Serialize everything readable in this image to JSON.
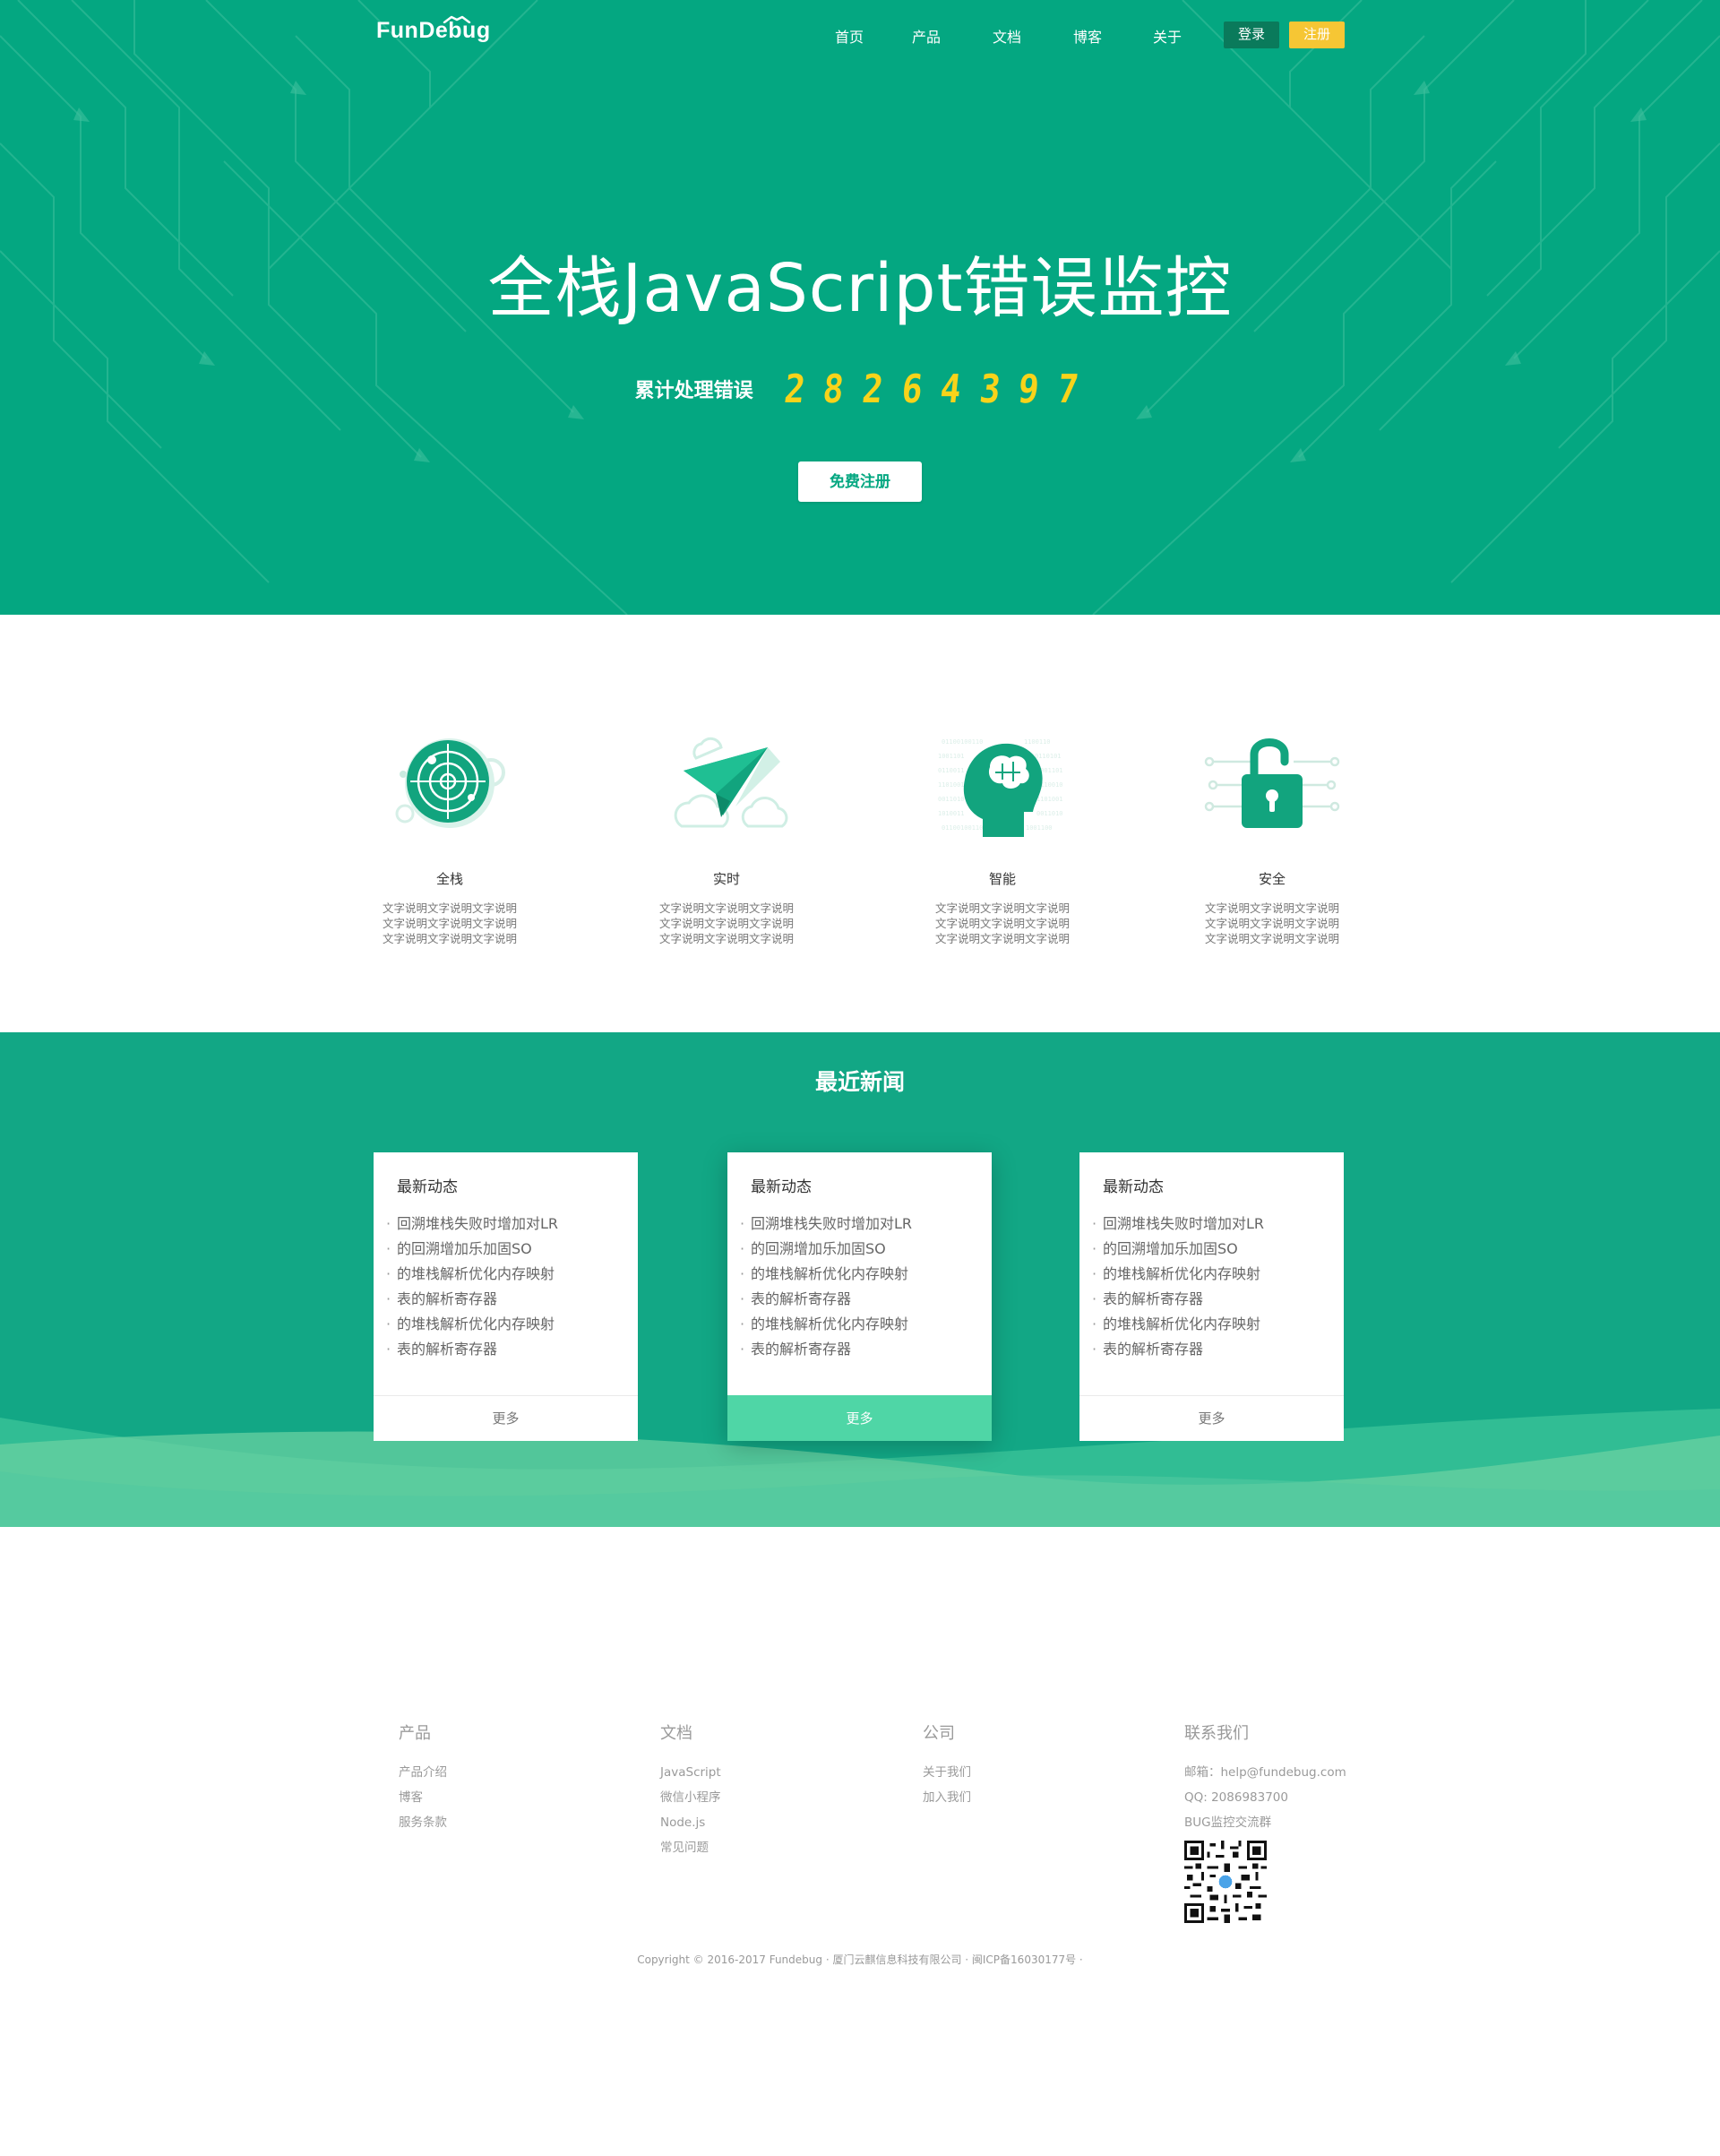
{
  "nav": {
    "logo": "FunDebug",
    "links": [
      "首页",
      "产品",
      "文档",
      "博客",
      "关于"
    ],
    "login": "登录",
    "register": "注册"
  },
  "hero": {
    "title": "全栈JavaScript错误监控",
    "counter_label": "累计处理错误",
    "counter_digits": [
      "2",
      "8",
      "2",
      "6",
      "4",
      "3",
      "9",
      "7"
    ],
    "cta": "免费注册"
  },
  "features": [
    {
      "icon": "radar-icon",
      "title": "全栈",
      "desc": [
        "文字说明文字说明文字说明",
        "文字说明文字说明文字说明",
        "文字说明文字说明文字说明"
      ]
    },
    {
      "icon": "paper-plane-icon",
      "title": "实时",
      "desc": [
        "文字说明文字说明文字说明",
        "文字说明文字说明文字说明",
        "文字说明文字说明文字说明"
      ]
    },
    {
      "icon": "brain-head-icon",
      "title": "智能",
      "desc": [
        "文字说明文字说明文字说明",
        "文字说明文字说明文字说明",
        "文字说明文字说明文字说明"
      ]
    },
    {
      "icon": "unlocked-padlock-icon",
      "title": "安全",
      "desc": [
        "文字说明文字说明文字说明",
        "文字说明文字说明文字说明",
        "文字说明文字说明文字说明"
      ]
    }
  ],
  "news": {
    "heading": "最近新闻",
    "cards": [
      {
        "title": "最新动态",
        "items": [
          "回溯堆栈失败时增加对LR",
          "的回溯增加乐加固SO",
          "的堆栈解析优化内存映射",
          "表的解析寄存器",
          "的堆栈解析优化内存映射",
          "表的解析寄存器"
        ],
        "more": "更多"
      },
      {
        "title": "最新动态",
        "items": [
          "回溯堆栈失败时增加对LR",
          "的回溯增加乐加固SO",
          "的堆栈解析优化内存映射",
          "表的解析寄存器",
          "的堆栈解析优化内存映射",
          "表的解析寄存器"
        ],
        "more": "更多"
      },
      {
        "title": "最新动态",
        "items": [
          "回溯堆栈失败时增加对LR",
          "的回溯增加乐加固SO",
          "的堆栈解析优化内存映射",
          "表的解析寄存器",
          "的堆栈解析优化内存映射",
          "表的解析寄存器"
        ],
        "more": "更多"
      }
    ],
    "bullet": "·"
  },
  "footer": {
    "product": {
      "title": "产品",
      "links": [
        "产品介绍",
        "博客",
        "服务条款"
      ]
    },
    "docs": {
      "title": "文档",
      "links": [
        "JavaScript",
        "微信小程序",
        "Node.js",
        "常见问题"
      ]
    },
    "company": {
      "title": "公司",
      "links": [
        "关于我们",
        "加入我们"
      ]
    },
    "contact": {
      "title": "联系我们",
      "email": "邮箱：help@fundebug.com",
      "qq": "QQ: 2086983700",
      "group": "BUG监控交流群"
    },
    "copyright": "Copyright © 2016-2017 Fundebug · 厦门云麒信息科技有限公司 · 闽ICP备16030177号 ·"
  },
  "colors": {
    "brand_green": "#04a781",
    "news_green": "#12a785",
    "accent_yellow": "#f6c634",
    "counter_yellow": "#f8d31a",
    "featured_more": "#4fd6a6",
    "login_dark": "#0a7a5b"
  }
}
